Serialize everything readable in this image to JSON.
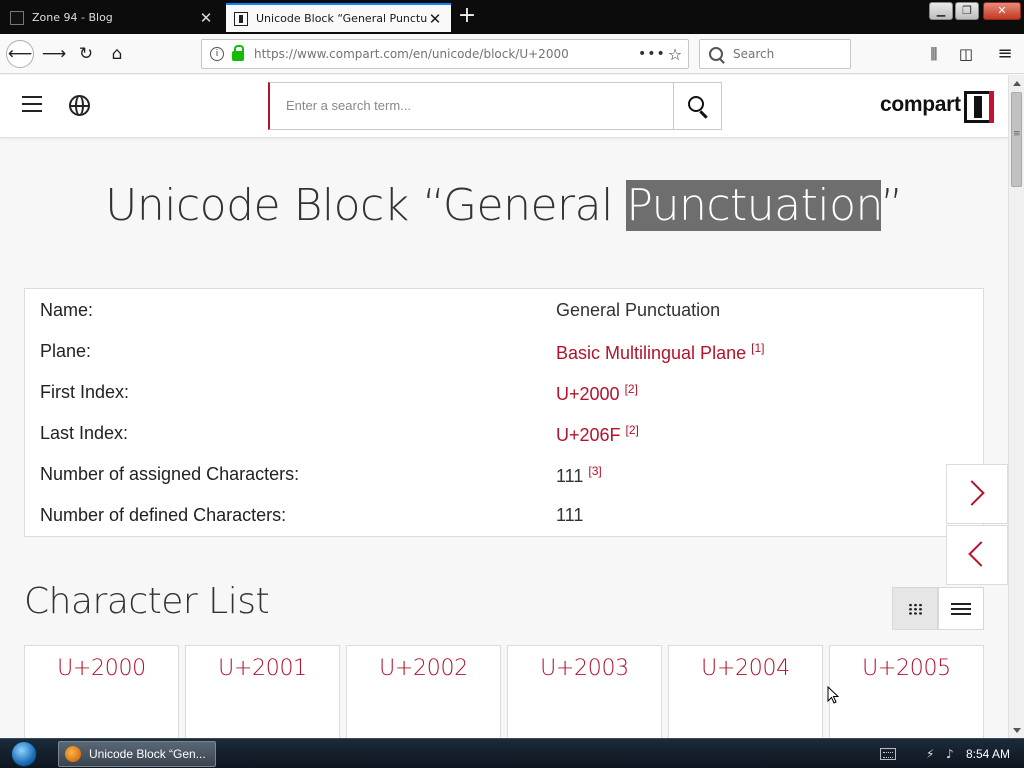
{
  "browser": {
    "tabs": [
      {
        "title": "Zone 94 - Blog",
        "active": false
      },
      {
        "title": "Unicode Block “General Punctuation”",
        "active": true
      }
    ],
    "new_tab": "+",
    "url_domain": "https://www.compart.com",
    "url_path": "/en/unicode/block/U+2000",
    "search_placeholder": "Search",
    "page_actions": "•••"
  },
  "site": {
    "search_placeholder": "Enter a search term...",
    "logo_text": "compart"
  },
  "page": {
    "title_before": "Unicode Block “General ",
    "title_highlight": "Punctuation",
    "title_after": "”",
    "info": [
      {
        "label": "Name:",
        "value": "General Punctuation",
        "link": false,
        "ref": ""
      },
      {
        "label": "Plane:",
        "value": "Basic Multilingual Plane",
        "link": true,
        "ref": "[1]"
      },
      {
        "label": "First Index:",
        "value": "U+2000",
        "link": true,
        "ref": "[2]"
      },
      {
        "label": "Last Index:",
        "value": "U+206F",
        "link": true,
        "ref": "[2]"
      },
      {
        "label": "Number of assigned Characters:",
        "value": "111",
        "link": false,
        "ref": "[3]"
      },
      {
        "label": "Number of defined Characters:",
        "value": "111",
        "link": false,
        "ref": ""
      }
    ],
    "char_list_title": "Character List",
    "characters": [
      "U+2000",
      "U+2001",
      "U+2002",
      "U+2003",
      "U+2004",
      "U+2005"
    ]
  },
  "taskbar": {
    "window_title": "Unicode Block “Gen...",
    "clock": "8:54 AM"
  },
  "colors": {
    "accent": "#b5122b",
    "highlight": "#6e6e6e"
  }
}
